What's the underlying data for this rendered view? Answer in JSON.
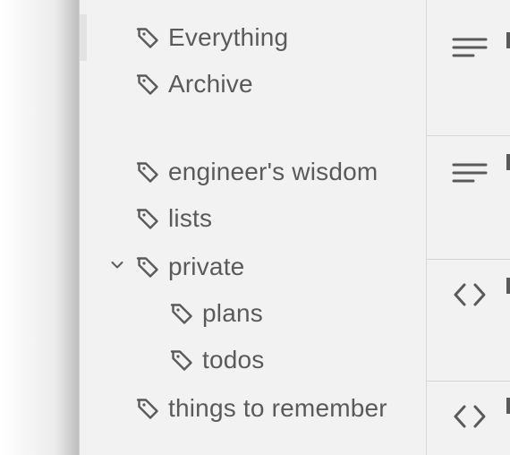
{
  "sidebar": {
    "items": [
      {
        "label": "Everything",
        "icon": "tag-icon",
        "level": 0,
        "selected": true
      },
      {
        "label": "Archive",
        "icon": "tag-icon",
        "level": 0
      },
      {
        "label": "engineer's wisdom",
        "icon": "tag-icon",
        "level": 0
      },
      {
        "label": "lists",
        "icon": "tag-icon",
        "level": 0
      },
      {
        "label": "private",
        "icon": "tag-icon",
        "level": 0,
        "expanded": true
      },
      {
        "label": "plans",
        "icon": "tag-icon",
        "level": 1
      },
      {
        "label": "todos",
        "icon": "tag-icon",
        "level": 1
      },
      {
        "label": "things to remember",
        "icon": "tag-icon",
        "level": 0
      }
    ]
  },
  "notes": {
    "items": [
      {
        "icon": "text-lines-icon"
      },
      {
        "icon": "text-lines-icon"
      },
      {
        "icon": "code-brackets-icon"
      },
      {
        "icon": "code-brackets-icon"
      }
    ]
  },
  "colors": {
    "text": "#5a5a5a",
    "sidebar_bg": "#f2f2f2",
    "selected_marker": "#e3e3e6",
    "divider": "#d6d6d6"
  }
}
